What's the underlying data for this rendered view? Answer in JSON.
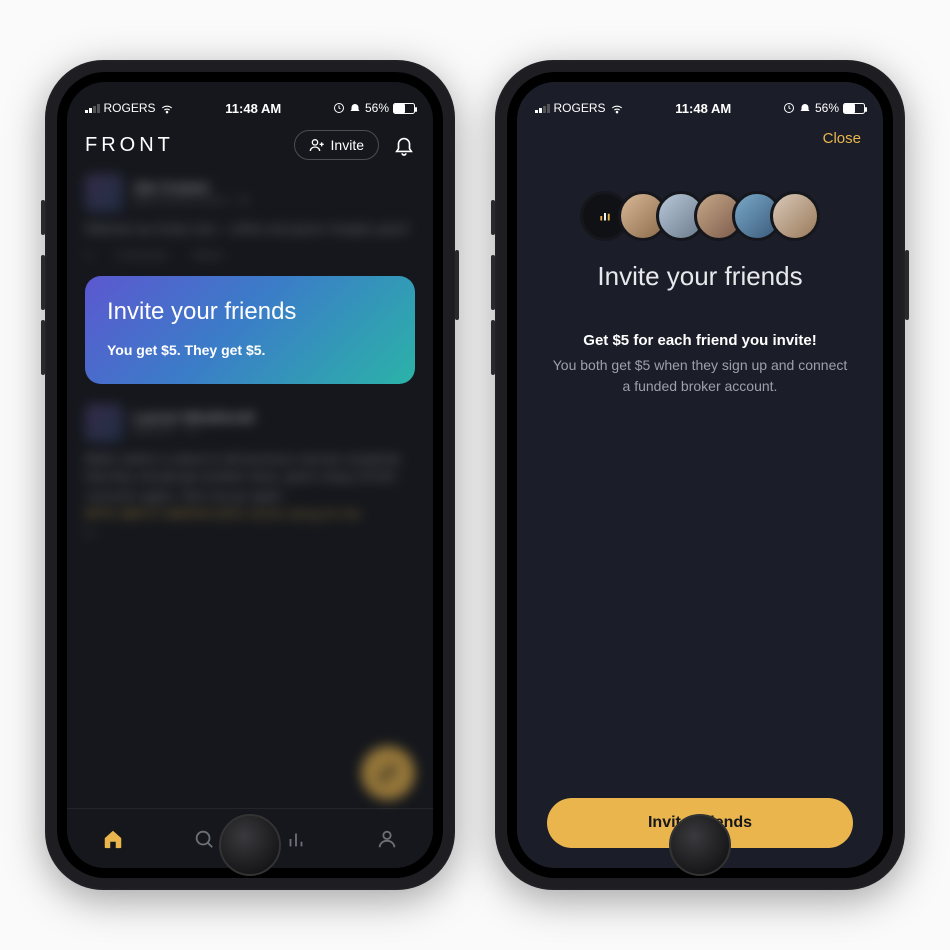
{
  "status": {
    "carrier": "ROGERS",
    "time": "11:48 AM",
    "battery_pct": "56%"
  },
  "phone1": {
    "logo": "FRONT",
    "invite_pill": "Invite",
    "feed": {
      "post1": {
        "name": "Jim Cramer",
        "handle": "@jimcramercontent · 5h",
        "body": "Walmart up nicely now – online and gross margins good",
        "comment": "Comment",
        "share": "Share",
        "count": "4"
      },
      "invite_card": {
        "title": "Invite your friends",
        "sub": "You get $5. They get $5."
      },
      "post2": {
        "name": "Lauren Weatherall",
        "handle": "@lauren · 1d",
        "body1": "Biden admin is about to tell previous vaccine recipients that they should get another dose, given rising COVID concerns again. Here we go again.",
        "body2": "$PFE $BNTX $MRNA $JNJ stocks along for the",
        "body3": "r..."
      }
    }
  },
  "phone2": {
    "close": "Close",
    "title": "Invite your friends",
    "lead": "Get $5 for each friend you invite!",
    "desc": "You both get $5 when they sign up and connect a funded broker account.",
    "button": "Invite Friends"
  }
}
